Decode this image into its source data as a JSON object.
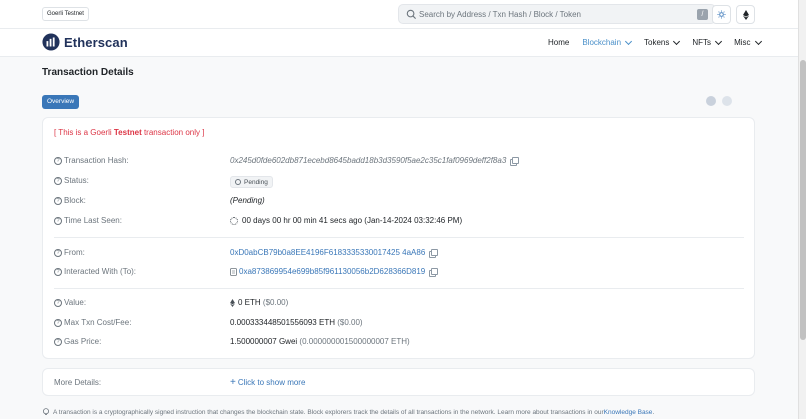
{
  "header": {
    "network_badge": "Goerli Testnet",
    "search_placeholder": "Search by Address / Txn Hash / Block / Token",
    "slash_key": "/"
  },
  "nav": {
    "brand": "Etherscan",
    "items": [
      {
        "label": "Home",
        "active": false,
        "dropdown": false
      },
      {
        "label": "Blockchain",
        "active": true,
        "dropdown": true
      },
      {
        "label": "Tokens",
        "active": false,
        "dropdown": true
      },
      {
        "label": "NFTs",
        "active": false,
        "dropdown": true
      },
      {
        "label": "Misc",
        "active": false,
        "dropdown": true
      }
    ]
  },
  "page": {
    "title": "Transaction Details",
    "tab_overview": "Overview"
  },
  "details": {
    "testnet_prefix": "[ This is a Goerli ",
    "testnet_bold": "Testnet",
    "testnet_suffix": " transaction only ]",
    "rows": {
      "hash": {
        "label": "Transaction Hash:",
        "value": "0x245d0fde602db871ecebd8645badd18b3d3590f5ae2c35c1faf0969deff2f8a3"
      },
      "status": {
        "label": "Status:",
        "value": "Pending"
      },
      "block": {
        "label": "Block:",
        "value": "(Pending)"
      },
      "time": {
        "label": "Time Last Seen:",
        "value": "00 days 00 hr 00 min 41 secs ago (Jan-14-2024 03:32:46 PM)"
      },
      "from": {
        "label": "From:",
        "value": "0xD0abCB79b0a8EE4196F6183335330017425 4aA86"
      },
      "to": {
        "label": "Interacted With (To):",
        "value": "0xa873869954e699b85f961130056b2D628366D819"
      },
      "value": {
        "label": "Value:",
        "amount": "0 ETH",
        "usd": "($0.00)"
      },
      "fee": {
        "label": "Max Txn Cost/Fee:",
        "amount": "0.000333448501556093 ETH",
        "usd": "($0.00)"
      },
      "gas": {
        "label": "Gas Price:",
        "amount": "1.500000007 Gwei",
        "eth": "(0.000000001500000007 ETH)"
      }
    },
    "more_details_label": "More Details:",
    "show_more": "Click to show more"
  },
  "footer": {
    "note": "A transaction is a cryptographically signed instruction that changes the blockchain state. Block explorers track the details of all transactions in the network. Learn more about transactions in our ",
    "link": "Knowledge Base",
    "end": "."
  },
  "colors": {
    "accent": "#3a77b8",
    "danger": "#dc3545",
    "brand": "#21325b"
  }
}
